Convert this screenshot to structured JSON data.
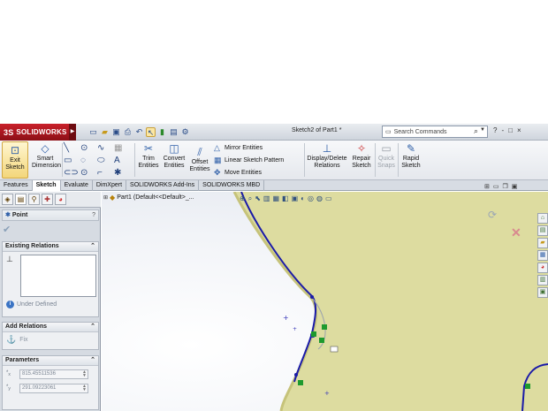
{
  "app": {
    "brand": "SOLIDWORKS",
    "brand_mark": "3S",
    "document_title": "Sketch2 of Part1 *"
  },
  "search": {
    "placeholder": "Search Commands"
  },
  "window_controls": [
    "?",
    "-",
    "□",
    "×"
  ],
  "command_manager": {
    "exit_sketch": "Exit Sketch",
    "smart_dimension": "Smart Dimension",
    "trim_entities": "Trim Entities",
    "convert_entities": "Convert Entities",
    "offset_entities": "Offset Entities",
    "mirror_entities": "Mirror Entities",
    "linear_sketch_pattern": "Linear Sketch Pattern",
    "move_entities": "Move Entities",
    "display_delete_relations": "Display/Delete Relations",
    "repair_sketch": "Repair Sketch",
    "quick_snaps": "Quick Snaps",
    "rapid_sketch": "Rapid Sketch"
  },
  "tabs": [
    {
      "label": "Features",
      "active": false
    },
    {
      "label": "Sketch",
      "active": true
    },
    {
      "label": "Evaluate",
      "active": false
    },
    {
      "label": "DimXpert",
      "active": false
    },
    {
      "label": "SOLIDWORKS Add-Ins",
      "active": false
    },
    {
      "label": "SOLIDWORKS MBD",
      "active": false
    }
  ],
  "property_manager": {
    "title": "Point",
    "help": "?",
    "existing_relations": {
      "header": "Existing Relations",
      "status": "Under Defined"
    },
    "add_relations": {
      "header": "Add Relations",
      "fix": "Fix"
    },
    "parameters": {
      "header": "Parameters",
      "x_label": "x",
      "x_value": "815.45511536",
      "y_label": "y",
      "y_value": "291.09223061"
    }
  },
  "feature_tree": {
    "item": "Part1  (Default<<Default>_..."
  },
  "colors": {
    "face": "#dddca0",
    "sketch_line": "#1a1aa8",
    "relation_marker": "#1e9a2e",
    "accent_red": "#c9202a"
  }
}
